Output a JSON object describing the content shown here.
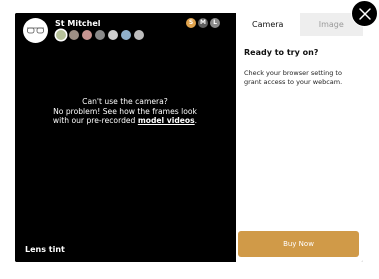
{
  "frame": {
    "name": "St Mitchel",
    "colors": [
      {
        "name": "sage",
        "hex": "#b7c29a",
        "selected": true
      },
      {
        "name": "taupe",
        "hex": "#9d8f84"
      },
      {
        "name": "rose",
        "hex": "#c89591"
      },
      {
        "name": "grey",
        "hex": "#8a8a8a"
      },
      {
        "name": "silver",
        "hex": "#cfcfcf"
      },
      {
        "name": "blue",
        "hex": "#8fb0cc"
      },
      {
        "name": "light-grey",
        "hex": "#bdbdbd"
      }
    ],
    "sizes": [
      {
        "label": "S",
        "hex": "#e0a34d"
      },
      {
        "label": "M",
        "hex": "#5f5f5f"
      },
      {
        "label": "L",
        "hex": "#8a8a8a"
      }
    ]
  },
  "camera": {
    "message_line1": "Can't use the camera?",
    "message_line2": "No problem! See how the frames look",
    "message_line3": "with our pre-recorded",
    "link_text": "model videos",
    "link_suffix": ".",
    "lens_tint_label": "Lens tint"
  },
  "panel": {
    "tabs": [
      "Camera",
      "Image"
    ],
    "title": "Ready to try on?",
    "body": "Check your browser setting to grant access to your webcam.",
    "buy_label": "Buy Now"
  },
  "colors": {
    "accent": "#d09a48",
    "background": "#000000"
  }
}
